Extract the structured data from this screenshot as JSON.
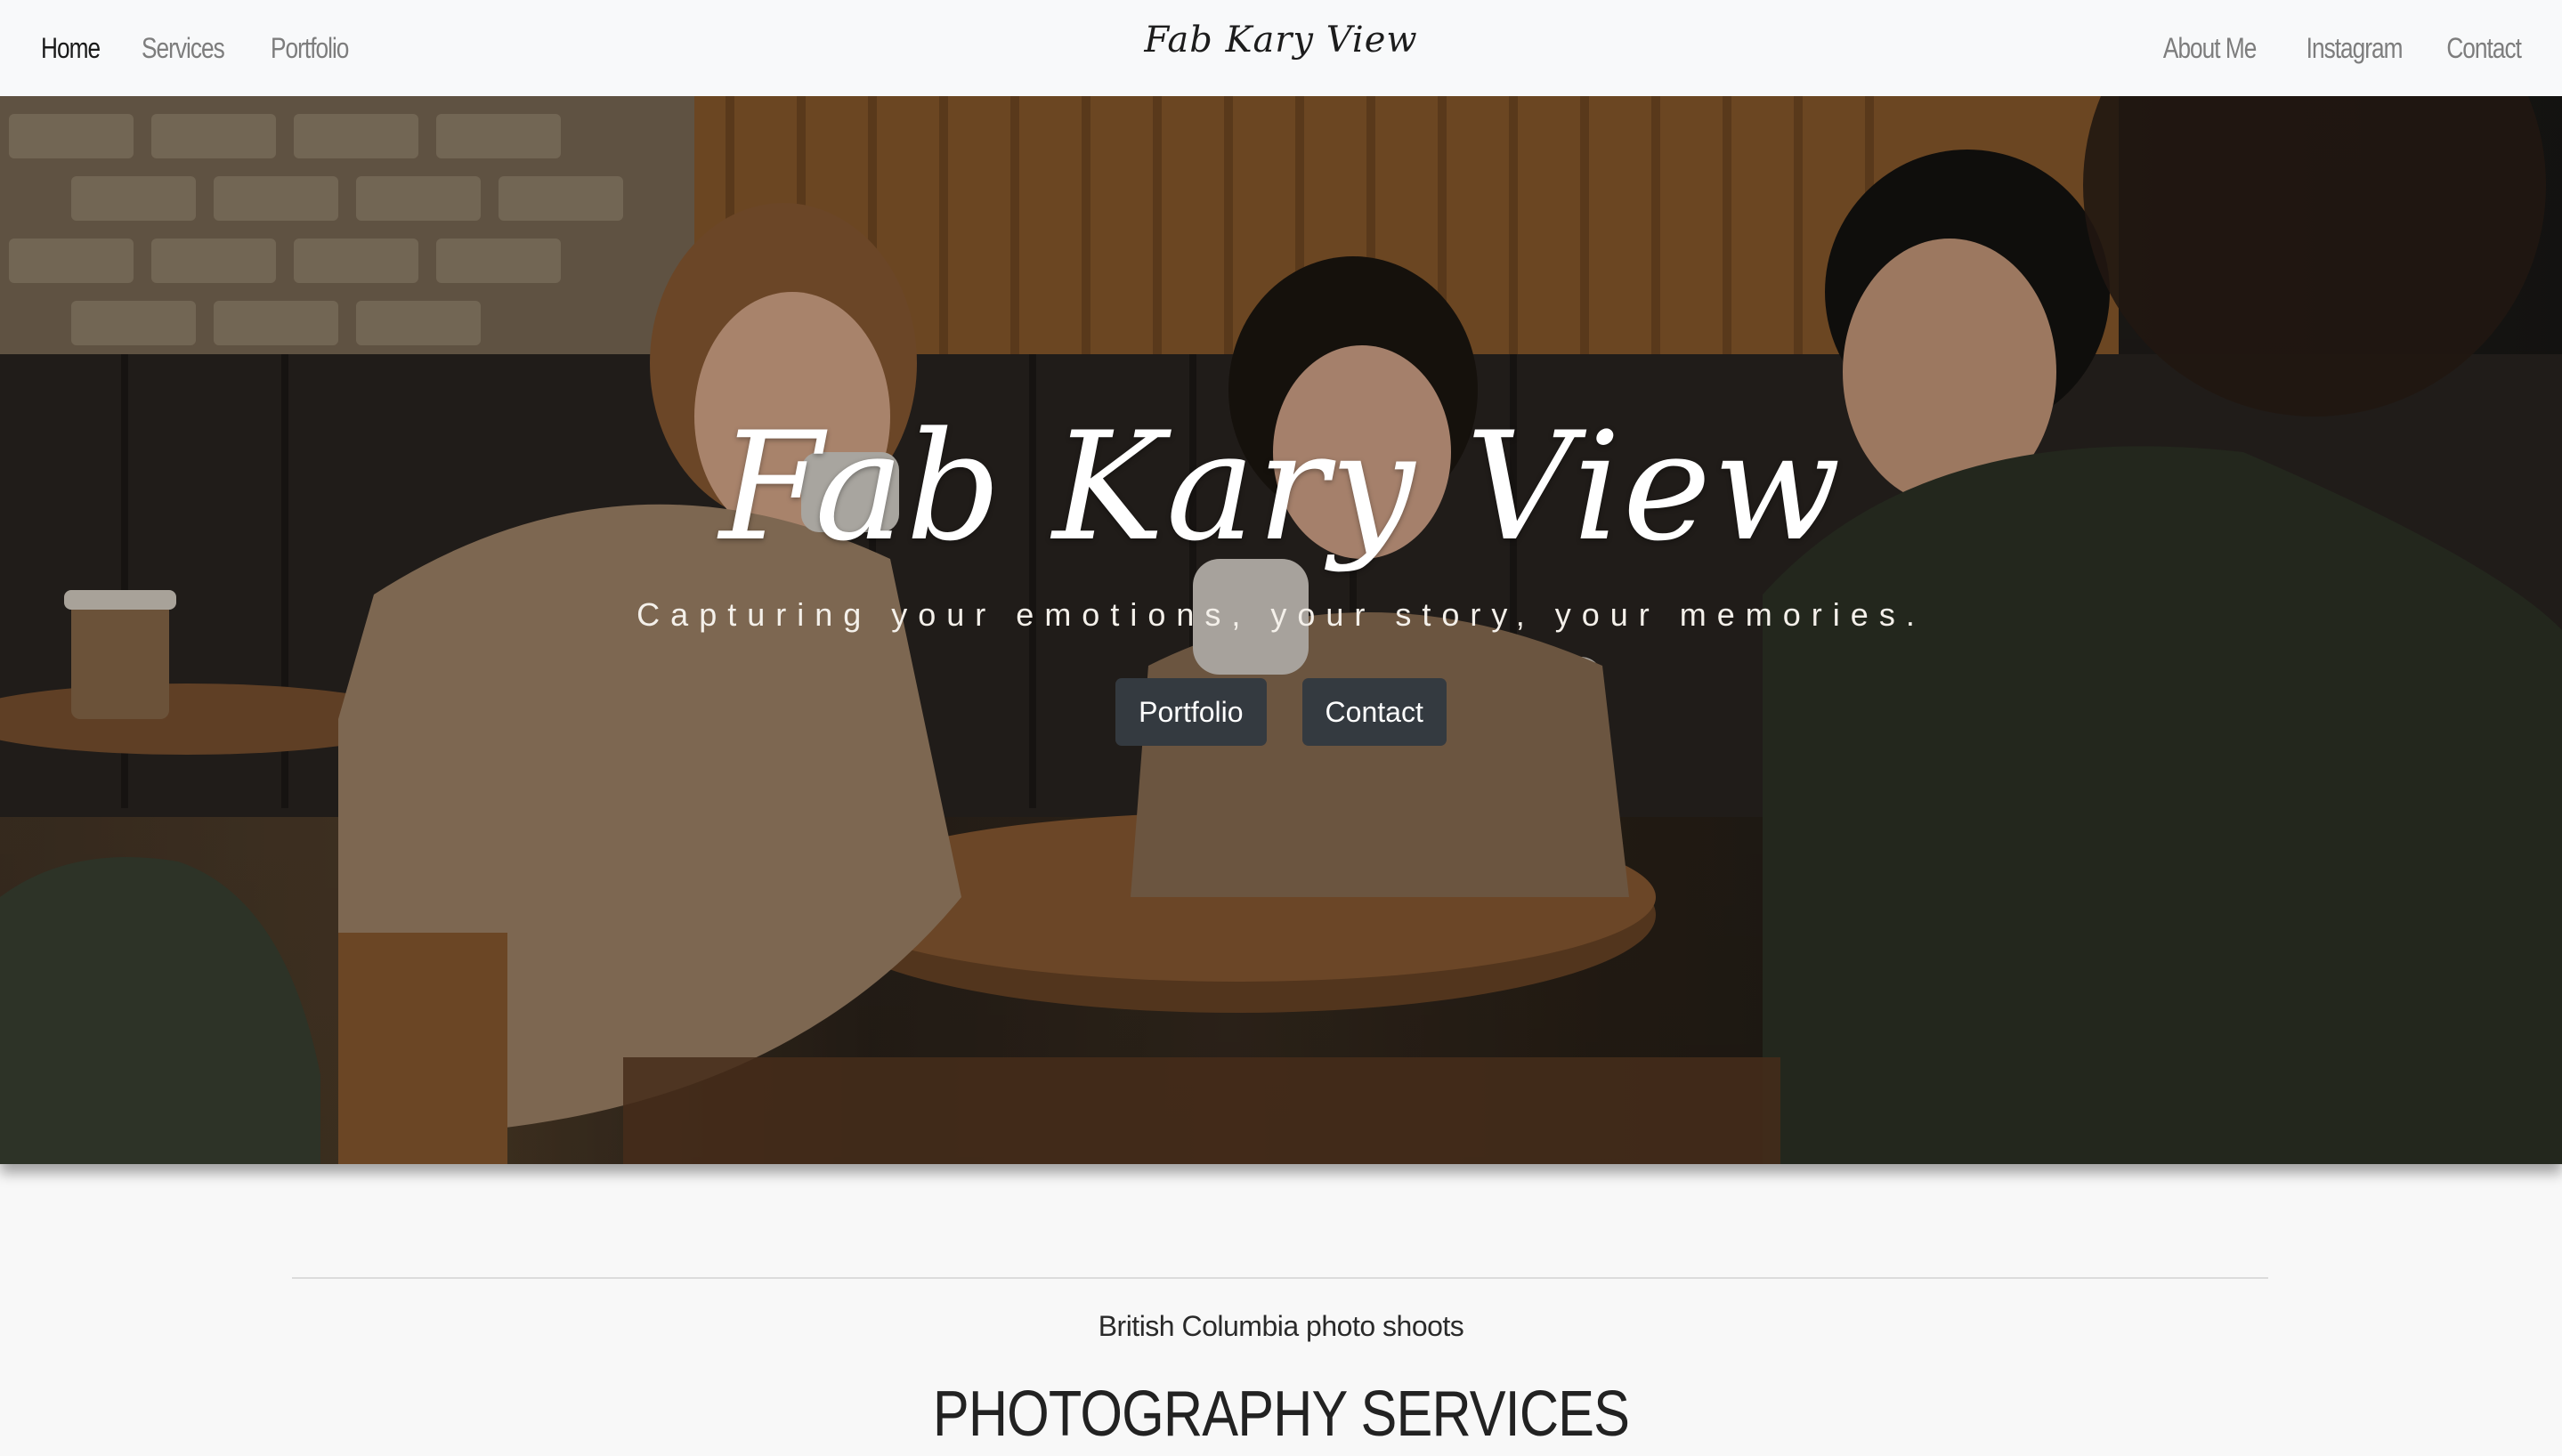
{
  "nav": {
    "left": [
      {
        "label": "Home",
        "active": true
      },
      {
        "label": "Services",
        "active": false
      },
      {
        "label": "Portfolio",
        "active": false
      }
    ],
    "brand": "Fab Kary View",
    "right": [
      {
        "label": "About Me"
      },
      {
        "label": "Instagram"
      },
      {
        "label": "Contact"
      }
    ]
  },
  "hero": {
    "title": "Fab Kary View",
    "tagline": "Capturing your emotions, your story, your memories.",
    "buttons": {
      "portfolio": "Portfolio",
      "contact": "Contact"
    },
    "image_alt": "People drinking coffee in a cafe"
  },
  "section": {
    "subtitle": "British Columbia photo shoots",
    "title": "PHOTOGRAPHY SERVICES"
  },
  "colors": {
    "navbar_bg": "#f8f9fa",
    "button_bg": "#343a40",
    "page_bg": "#f8f8f8"
  }
}
